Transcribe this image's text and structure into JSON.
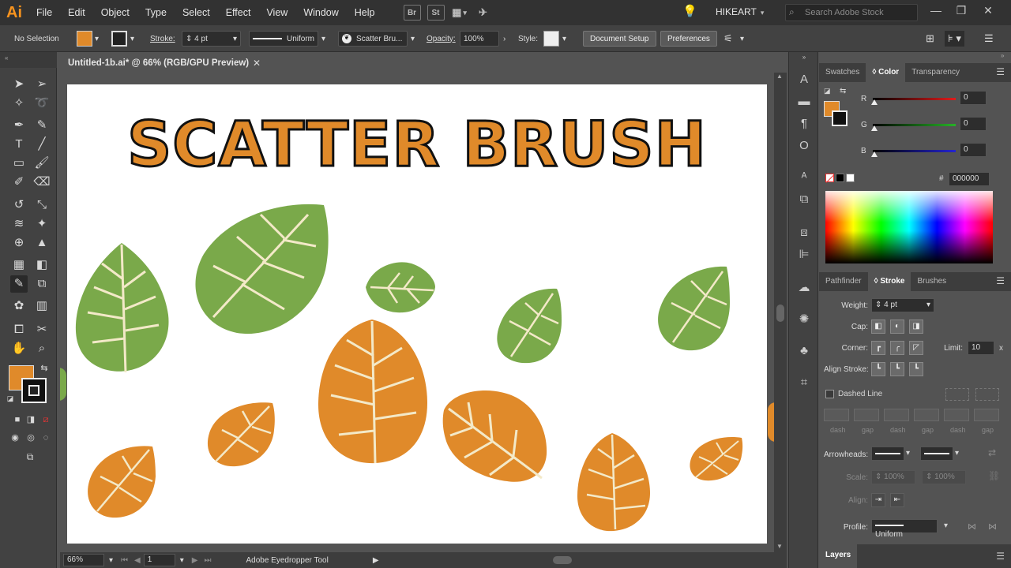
{
  "menubar": {
    "app_logo": "Ai",
    "items": [
      "File",
      "Edit",
      "Object",
      "Type",
      "Select",
      "Effect",
      "View",
      "Window",
      "Help"
    ],
    "bridge_label": "Br",
    "stock_label": "St",
    "user": "HIKEART",
    "search_placeholder": "Search Adobe Stock"
  },
  "controlbar": {
    "selection": "No Selection",
    "fill_color": "#e08a2a",
    "stroke_label": "Stroke:",
    "stroke_value": "4 pt",
    "profile_label": "Uniform",
    "brush_label": "Scatter Bru...",
    "opacity_label": "Opacity:",
    "opacity_value": "100%",
    "style_label": "Style:",
    "doc_setup": "Document Setup",
    "preferences": "Preferences"
  },
  "document": {
    "tab_title": "Untitled-1b.ai* @ 66% (RGB/GPU Preview)",
    "artboard_title": "SCATTER BRUSH",
    "leaf_colors": {
      "green": "#7aa94a",
      "orange": "#e08a2a",
      "vein": "#f3e9c8"
    }
  },
  "statusbar": {
    "zoom": "66%",
    "artboard": "1",
    "tool": "Adobe Eyedropper Tool"
  },
  "color_panel": {
    "tabs": [
      "Swatches",
      "Color",
      "Transparency"
    ],
    "active_tab": "Color",
    "channels": [
      {
        "name": "R",
        "value": "0",
        "color": "#e21b1b"
      },
      {
        "name": "G",
        "value": "0",
        "color": "#27b227"
      },
      {
        "name": "B",
        "value": "0",
        "color": "#2424d0"
      }
    ],
    "hex_label": "#",
    "hex": "000000"
  },
  "stroke_panel": {
    "tabs": [
      "Pathfinder",
      "Stroke",
      "Brushes"
    ],
    "active_tab": "Stroke",
    "weight_label": "Weight:",
    "weight_value": "4 pt",
    "cap_label": "Cap:",
    "corner_label": "Corner:",
    "limit_label": "Limit:",
    "limit_value": "10",
    "limit_unit": "x",
    "align_label": "Align Stroke:",
    "dashed_label": "Dashed Line",
    "dash_labels": [
      "dash",
      "gap",
      "dash",
      "gap",
      "dash",
      "gap"
    ],
    "arrowheads_label": "Arrowheads:",
    "scale_label": "Scale:",
    "scale_values": [
      "100%",
      "100%"
    ],
    "align_arrows_label": "Align:",
    "profile_label": "Profile:",
    "profile_value": "Uniform"
  },
  "layers_panel": {
    "title": "Layers"
  }
}
